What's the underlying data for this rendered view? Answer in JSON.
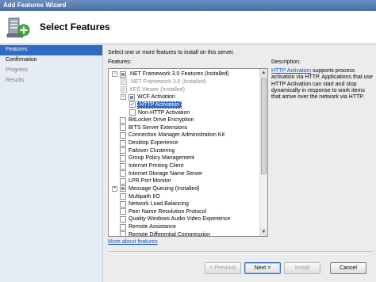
{
  "window": {
    "title": "Add Features Wizard"
  },
  "header": {
    "title": "Select Features"
  },
  "nav": [
    {
      "label": "Features",
      "state": "active"
    },
    {
      "label": "Confirmation",
      "state": "normal"
    },
    {
      "label": "Progress",
      "state": "disabled"
    },
    {
      "label": "Results",
      "state": "disabled"
    }
  ],
  "content": {
    "intro": "Select one or more features to install on this server.",
    "features_label": "Features:",
    "description_label": "Description:",
    "description_link": "HTTP Activation",
    "description_text": " supports process activation via HTTP. Applications that use HTTP Activation can start and stop dynamically in response to work items that arrive over the network via HTTP.",
    "more_link": "More about features"
  },
  "features": [
    {
      "indent": 0,
      "expander": "−",
      "check": "partial",
      "label": ".NET Framework 3.0 Features  (Installed)",
      "style": "normal"
    },
    {
      "indent": 1,
      "expander": "",
      "check": "checked-disabled",
      "label": ".NET Framework 3.0  (Installed)",
      "style": "grey"
    },
    {
      "indent": 1,
      "expander": "",
      "check": "checked-disabled",
      "label": "XPS Viewer  (Installed)",
      "style": "grey"
    },
    {
      "indent": 1,
      "expander": "−",
      "check": "partial",
      "label": "WCF Activation",
      "style": "normal"
    },
    {
      "indent": 2,
      "expander": "",
      "check": "checked",
      "label": "HTTP Activation",
      "style": "selected"
    },
    {
      "indent": 2,
      "expander": "",
      "check": "unchecked",
      "label": "Non-HTTP Activation",
      "style": "normal"
    },
    {
      "indent": 0,
      "expander": "",
      "check": "unchecked",
      "label": "BitLocker Drive Encryption",
      "style": "normal"
    },
    {
      "indent": 0,
      "expander": "",
      "check": "unchecked",
      "label": "BITS Server Extensions",
      "style": "normal"
    },
    {
      "indent": 0,
      "expander": "",
      "check": "unchecked",
      "label": "Connection Manager Administration Kit",
      "style": "normal"
    },
    {
      "indent": 0,
      "expander": "",
      "check": "unchecked",
      "label": "Desktop Experience",
      "style": "normal"
    },
    {
      "indent": 0,
      "expander": "",
      "check": "unchecked",
      "label": "Failover Clustering",
      "style": "normal"
    },
    {
      "indent": 0,
      "expander": "",
      "check": "unchecked",
      "label": "Group Policy Management",
      "style": "normal"
    },
    {
      "indent": 0,
      "expander": "",
      "check": "unchecked",
      "label": "Internet Printing Client",
      "style": "normal"
    },
    {
      "indent": 0,
      "expander": "",
      "check": "unchecked",
      "label": "Internet Storage Name Server",
      "style": "normal"
    },
    {
      "indent": 0,
      "expander": "",
      "check": "unchecked",
      "label": "LPR Port Monitor",
      "style": "normal"
    },
    {
      "indent": 0,
      "expander": "+",
      "check": "partial",
      "label": "Message Queuing  (Installed)",
      "style": "normal"
    },
    {
      "indent": 0,
      "expander": "",
      "check": "unchecked",
      "label": "Multipath I/O",
      "style": "normal"
    },
    {
      "indent": 0,
      "expander": "",
      "check": "unchecked",
      "label": "Network Load Balancing",
      "style": "normal"
    },
    {
      "indent": 0,
      "expander": "",
      "check": "unchecked",
      "label": "Peer Name Resolution Protocol",
      "style": "normal"
    },
    {
      "indent": 0,
      "expander": "",
      "check": "unchecked",
      "label": "Quality Windows Audio Video Experience",
      "style": "normal"
    },
    {
      "indent": 0,
      "expander": "",
      "check": "unchecked",
      "label": "Remote Assistance",
      "style": "normal"
    },
    {
      "indent": 0,
      "expander": "",
      "check": "unchecked",
      "label": "Remote Differential Compression",
      "style": "normal"
    }
  ],
  "buttons": {
    "previous": "< Previous",
    "next": "Next >",
    "install": "Install",
    "cancel": "Cancel"
  },
  "icons": {
    "header": "server-add-icon"
  }
}
